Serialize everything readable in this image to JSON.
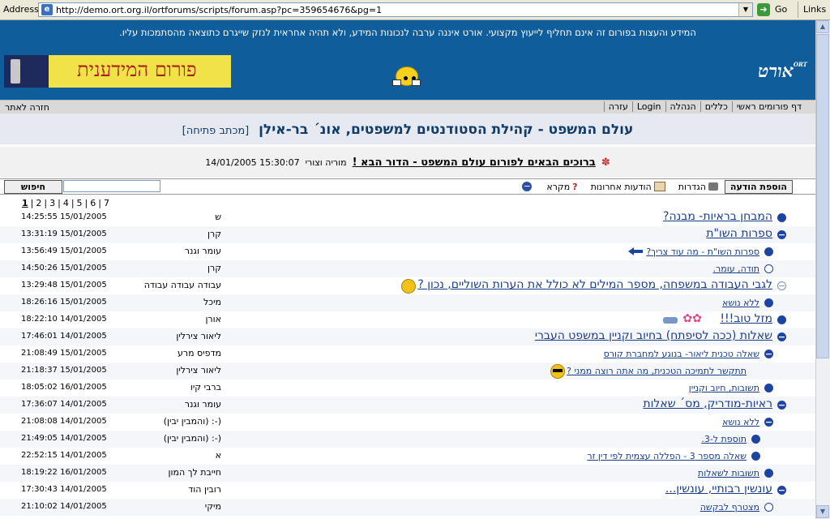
{
  "browser": {
    "address_label": "Address",
    "url": "http://demo.ort.org.il/ortforums/scripts/forum.asp?pc=359654676&pg=1",
    "go_label": "Go",
    "links_label": "Links"
  },
  "header": {
    "disclaimer": "המידע והעצות בפורום זה אינם תחליף לייעוץ מקצועי. אורט איננה ערבה לנכונות המידע, ולא תהיה אחראית לנזק שייגרם כתוצאה מהסתמכות עליו.",
    "banner_text": "פורום המידענית",
    "logo_text": "אורט",
    "logo_sup": "ORT"
  },
  "nav": {
    "back": "חזרה לאתר",
    "items": [
      "דף פורומים ראשי",
      "כללים",
      "הנהלה",
      "Login",
      "עזרה"
    ]
  },
  "forum": {
    "title": "עולם המשפט - קהילת הסטודנטים למשפטים, אונ´ בר-אילן",
    "opening_letter": "[מכתב פתיחה]"
  },
  "welcome": {
    "title": "ברוכים הבאים לפורום עולם המשפט - הדור הבא !",
    "author": "מוריה וצורי",
    "date": "15:30:07 14/01/2005"
  },
  "toolbar": {
    "search_label": "חיפוש",
    "add_message": "הוספת הודעה",
    "settings": "הגדרות",
    "recent": "הודעות אחרונות",
    "legend": "מקרא"
  },
  "pages": [
    "1",
    "2",
    "3",
    "4",
    "5",
    "6",
    "7"
  ],
  "messages": [
    {
      "title": "המבחן בראיות- מבנה?",
      "author": "ש",
      "date": "14:25:55 15/01/2005",
      "bullet": "full",
      "size": "big"
    },
    {
      "title": "ספרות השו\"ת",
      "author": "קרן",
      "date": "13:31:19 15/01/2005",
      "bullet": "minus",
      "size": "big"
    },
    {
      "title": "ספרות השו\"ת - מה עוד צריך?",
      "author": "עומר וגנר",
      "date": "13:56:49 15/01/2005",
      "bullet": "full",
      "size": "small"
    },
    {
      "title": "תודה, עומר.",
      "author": "קרן",
      "date": "14:50:26 15/01/2005",
      "bullet": "ring",
      "size": "small"
    },
    {
      "title": "לגבי העבודה במשפחה, מספר המילים לא כולל את הערות השוליים, נכון ?",
      "author": "עבודה עבודה עבודה",
      "date": "13:29:48 15/01/2005",
      "bullet": "minus-grey",
      "size": "big"
    },
    {
      "title": "ללא נושא",
      "author": "מיכל",
      "date": "18:26:16 15/01/2005",
      "bullet": "full",
      "size": "small"
    },
    {
      "title": "מזל טוב!!!",
      "author": "אורן",
      "date": "18:22:10 14/01/2005",
      "bullet": "full",
      "size": "big"
    },
    {
      "title": "שאלות (ככה לסיפתח) בחיוב וקניין במשפט העברי",
      "author": "ליאור צירלין",
      "date": "17:46:01 14/01/2005",
      "bullet": "minus",
      "size": "big"
    },
    {
      "title": "שאלה טכנית ליאור- בנוגע למחברת קורס",
      "author": "מדפיס מרע",
      "date": "21:08:49 15/01/2005",
      "bullet": "minus",
      "size": "small"
    },
    {
      "title": "תתקשר לתמיכה הטכנית, מה אתה רוצה ממני ?",
      "author": "ליאור צירלין",
      "date": "21:18:37 15/01/2005",
      "bullet": "none",
      "size": "small"
    },
    {
      "title": "תשובות, חיוב וקניין",
      "author": "ברבי קיו",
      "date": "18:05:02 16/01/2005",
      "bullet": "full",
      "size": "small"
    },
    {
      "title": "ראיות-מודריק, מס´ שאלות",
      "author": "עומר וגנר",
      "date": "17:36:07 14/01/2005",
      "bullet": "minus",
      "size": "big"
    },
    {
      "title": "ללא נושא",
      "author": "(-: (והמבין יבין)",
      "date": "21:08:08 14/01/2005",
      "bullet": "minus",
      "size": "small"
    },
    {
      "title": "תוספת ל-3.",
      "author": "(-: (והמבין יבין)",
      "date": "21:49:05 14/01/2005",
      "bullet": "full",
      "size": "small"
    },
    {
      "title": "שאלה מספר 3 - הפללה עצמית לפי דין זר",
      "author": "א",
      "date": "22:52:15 14/01/2005",
      "bullet": "full",
      "size": "small"
    },
    {
      "title": "תשובות לשאלות",
      "author": "חייבת לך המון",
      "date": "18:19:22 16/01/2005",
      "bullet": "full",
      "size": "small"
    },
    {
      "title": "עונשין רבותיי, עונשין...",
      "author": "רובין הוד",
      "date": "17:30:43 14/01/2005",
      "bullet": "minus",
      "size": "big"
    },
    {
      "title": "מצטרף לבקשה",
      "author": "מיקי",
      "date": "21:10:02 14/01/2005",
      "bullet": "ring",
      "size": "small"
    }
  ]
}
